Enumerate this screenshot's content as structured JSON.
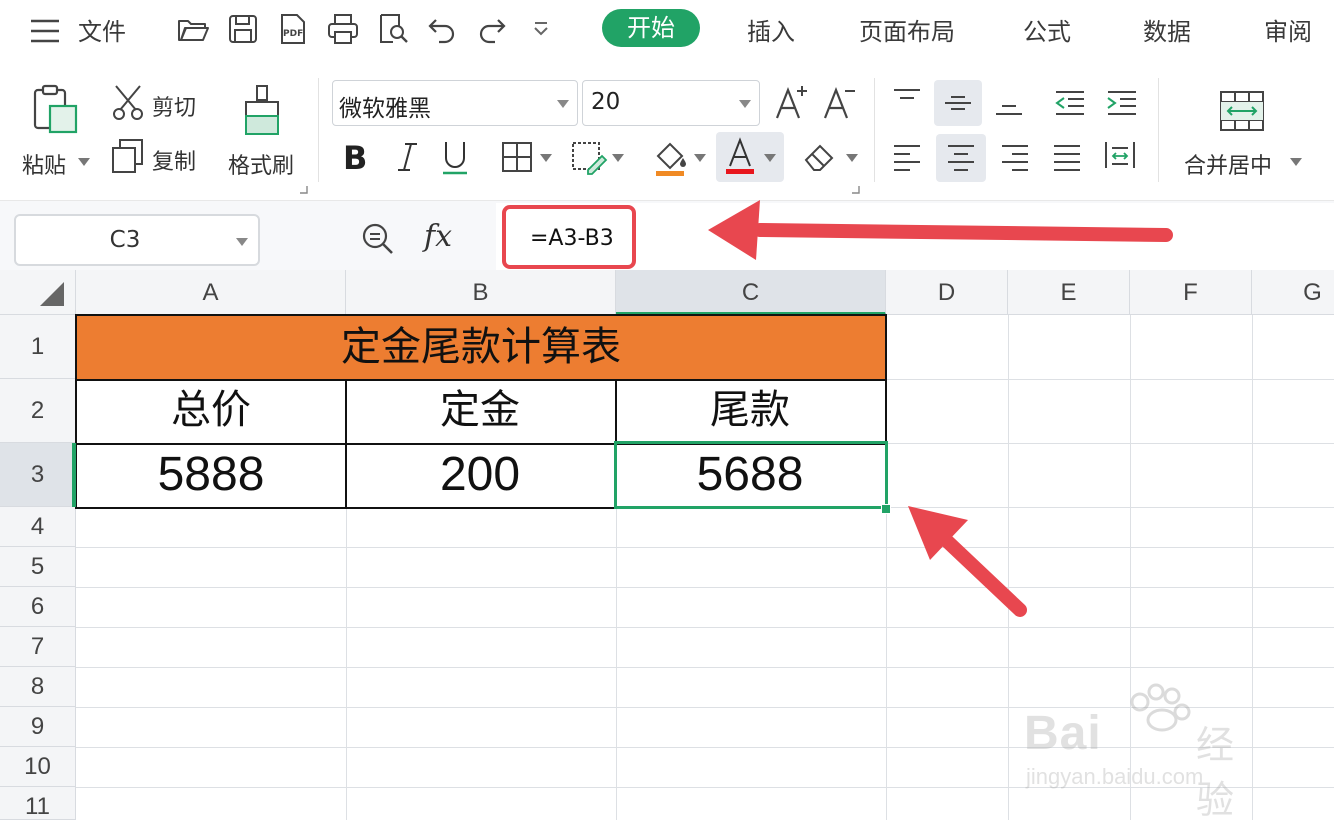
{
  "menubar": {
    "file_label": "文件",
    "tabs": [
      "开始",
      "插入",
      "页面布局",
      "公式",
      "数据",
      "审阅"
    ],
    "active_tab": "开始"
  },
  "ribbon": {
    "paste_label": "粘贴",
    "cut_label": "剪切",
    "copy_label": "复制",
    "format_painter_label": "格式刷",
    "font_name": "微软雅黑",
    "font_size": "20",
    "merge_center_label": "合并居中",
    "font_color": "#e8161d",
    "fill_color": "#f08a24"
  },
  "formula_bar": {
    "name_box": "C3",
    "fx_label": "fx",
    "formula": "=A3-B3"
  },
  "sheet": {
    "columns": [
      "A",
      "B",
      "C",
      "D",
      "E",
      "F",
      "G"
    ],
    "rows": [
      "1",
      "2",
      "3",
      "4",
      "5",
      "6",
      "7",
      "8",
      "9",
      "10",
      "11"
    ],
    "title": "定金尾款计算表",
    "headers": [
      "总价",
      "定金",
      "尾款"
    ],
    "values": [
      "5888",
      "200",
      "5688"
    ],
    "selected_cell": "C3",
    "accent_color": "#21a366",
    "title_fill": "#ed7d31"
  },
  "watermark": {
    "brand": "Bai",
    "brand_suffix": "经验",
    "url": "jingyan.baidu.com"
  }
}
